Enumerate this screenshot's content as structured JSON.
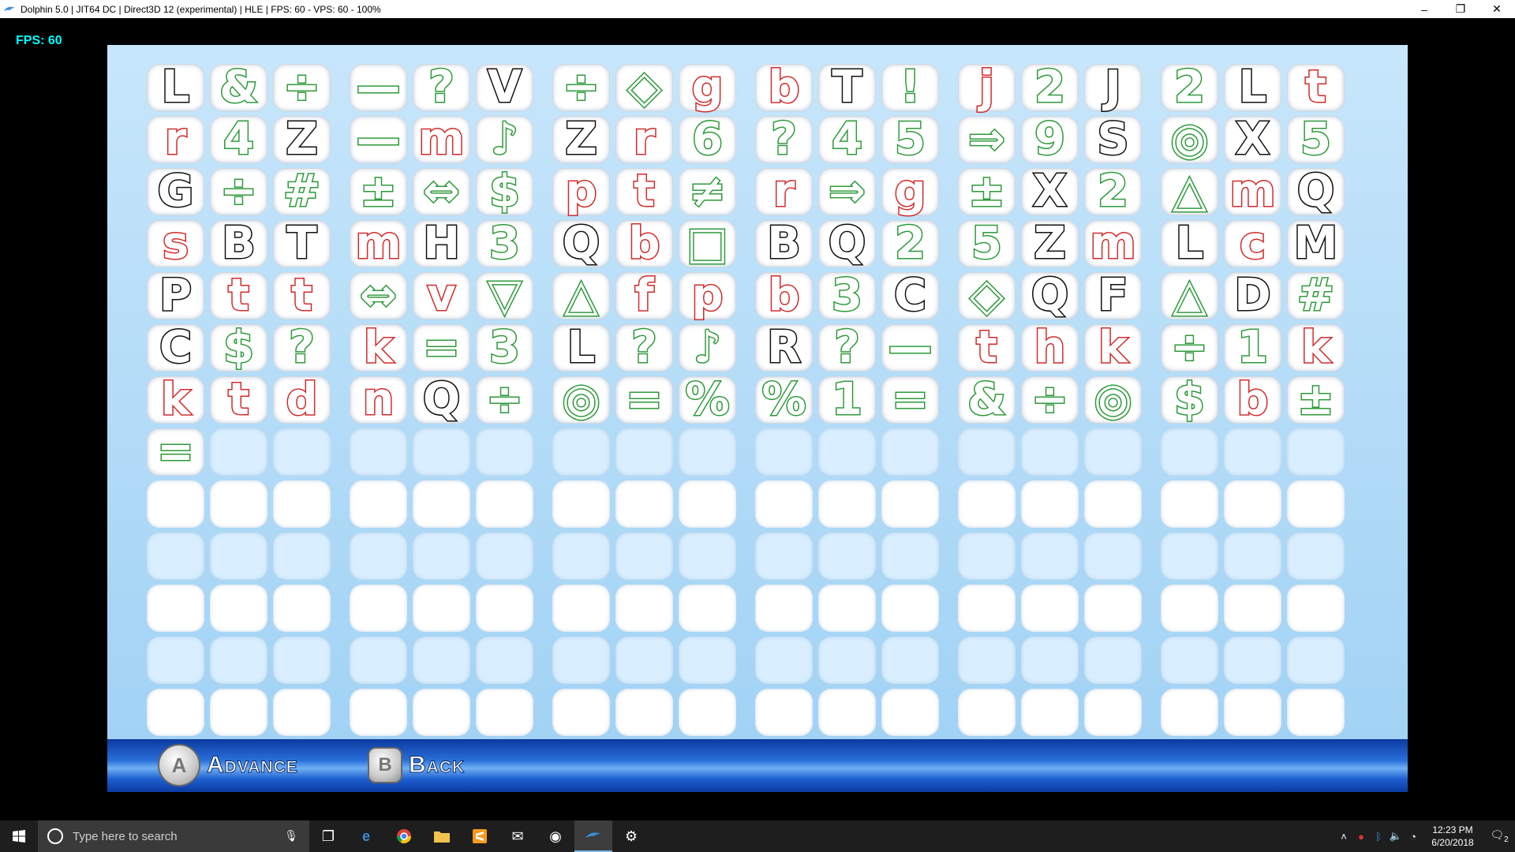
{
  "window": {
    "title": "Dolphin 5.0 | JIT64 DC | Direct3D 12 (experimental) | HLE | FPS: 60 - VPS: 60 - 100%",
    "minimize": "–",
    "restore": "❐",
    "close": "✕"
  },
  "overlay": {
    "fps": "FPS: 60"
  },
  "grid_rows": [
    [
      "L",
      "&",
      "÷",
      "—",
      "?",
      "V",
      "÷",
      "◇",
      "g",
      "b",
      "T",
      "!",
      "j",
      "2",
      "J",
      "2",
      "L",
      "t"
    ],
    [
      "r",
      "4",
      "Z",
      "—",
      "m",
      "♪",
      "Z",
      "r",
      "6",
      "?",
      "4",
      "5",
      "⇒",
      "9",
      "S",
      "◎",
      "X",
      "5"
    ],
    [
      "G",
      "÷",
      "#",
      "±",
      "⇔",
      "$",
      "p",
      "t",
      "≠",
      "r",
      "⇒",
      "g",
      "±",
      "X",
      "2",
      "△",
      "m",
      "Q"
    ],
    [
      "s",
      "B",
      "T",
      "m",
      "H",
      "3",
      "Q",
      "b",
      "□",
      "B",
      "Q",
      "2",
      "5",
      "Z",
      "m",
      "L",
      "c",
      "M"
    ],
    [
      "P",
      "t",
      "t",
      "⇔",
      "v",
      "▽",
      "△",
      "f",
      "p",
      "b",
      "3",
      "C",
      "◇",
      "Q",
      "F",
      "△",
      "D",
      "#"
    ],
    [
      "C",
      "$",
      "?",
      "k",
      "=",
      "3",
      "L",
      "?",
      "♪",
      "R",
      "?",
      "—",
      "t",
      "h",
      "k",
      "÷",
      "1",
      "k"
    ],
    [
      "k",
      "t",
      "d",
      "n",
      "Q",
      "÷",
      "◎",
      "=",
      "%",
      "%",
      "1",
      "=",
      "&",
      "÷",
      "◎",
      "$",
      "b",
      "±"
    ],
    [
      "=",
      "",
      "",
      "",
      "",
      "",
      "",
      "",
      "",
      "",
      "",
      "",
      "",
      "",
      "",
      "",
      "",
      ""
    ]
  ],
  "grid_colors": [
    [
      "black",
      "green",
      "green",
      "green",
      "green",
      "black",
      "green",
      "green",
      "red",
      "red",
      "black",
      "green",
      "red",
      "green",
      "black",
      "green",
      "black",
      "red"
    ],
    [
      "red",
      "green",
      "black",
      "green",
      "red",
      "green",
      "black",
      "red",
      "green",
      "green",
      "green",
      "green",
      "green",
      "green",
      "black",
      "green",
      "black",
      "green"
    ],
    [
      "black",
      "green",
      "green",
      "green",
      "green",
      "green",
      "red",
      "red",
      "green",
      "red",
      "green",
      "red",
      "green",
      "black",
      "green",
      "green",
      "red",
      "black"
    ],
    [
      "red",
      "black",
      "black",
      "red",
      "black",
      "green",
      "black",
      "red",
      "green",
      "black",
      "black",
      "green",
      "green",
      "black",
      "red",
      "black",
      "red",
      "black"
    ],
    [
      "black",
      "red",
      "red",
      "green",
      "red",
      "green",
      "green",
      "red",
      "red",
      "red",
      "green",
      "black",
      "green",
      "black",
      "black",
      "green",
      "black",
      "green"
    ],
    [
      "black",
      "green",
      "green",
      "red",
      "green",
      "green",
      "black",
      "green",
      "green",
      "black",
      "green",
      "green",
      "red",
      "red",
      "red",
      "green",
      "green",
      "red"
    ],
    [
      "red",
      "red",
      "red",
      "red",
      "black",
      "green",
      "green",
      "green",
      "green",
      "green",
      "green",
      "green",
      "green",
      "green",
      "green",
      "green",
      "red",
      "green"
    ],
    [
      "green",
      "",
      "",
      "",
      "",
      "",
      "",
      "",
      "",
      "",
      "",
      "",
      "",
      "",
      "",
      "",
      "",
      ""
    ]
  ],
  "bottom_bar": {
    "a_button": "A",
    "a_label": "Advance",
    "b_button": "B",
    "b_label": "Back"
  },
  "taskbar": {
    "search_placeholder": "Type here to search",
    "clock_time": "12:23 PM",
    "clock_date": "6/20/2018",
    "notifications": "2"
  }
}
